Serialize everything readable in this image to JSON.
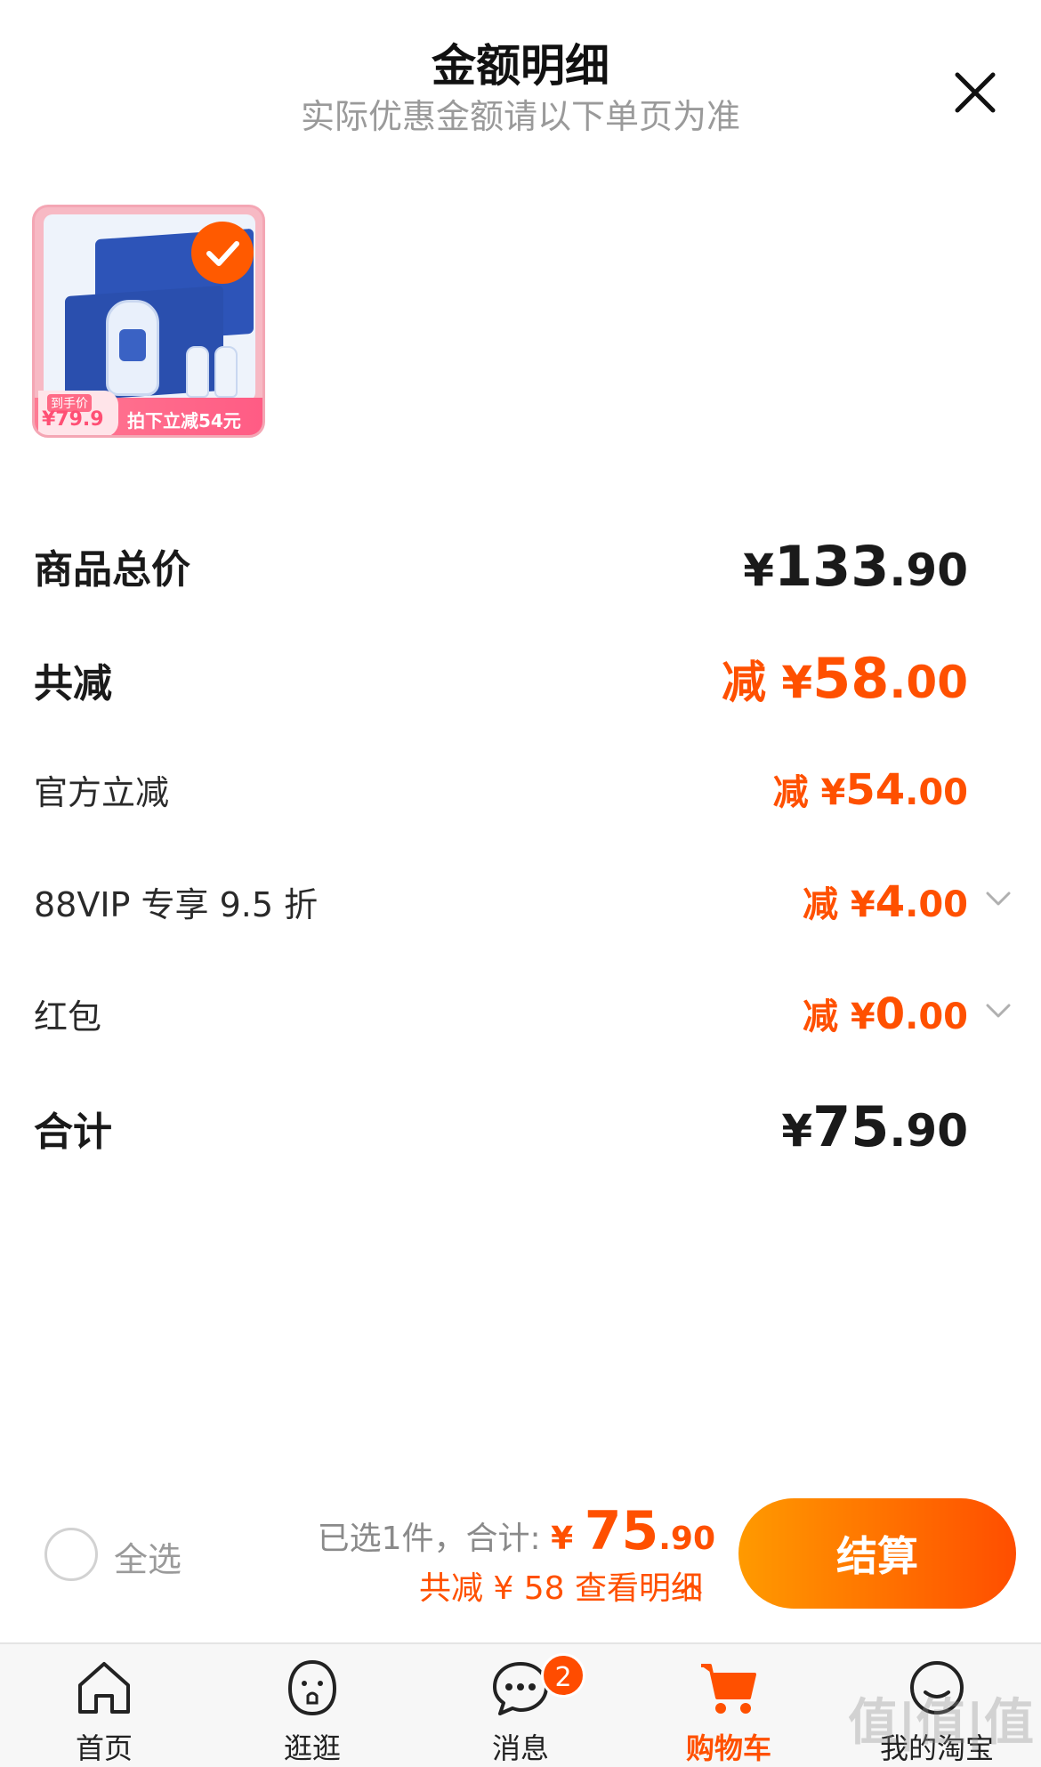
{
  "header": {
    "title": "金额明细",
    "subtitle": "实际优惠金额请以下单页为准"
  },
  "product": {
    "tag": "到手价",
    "price": "¥79.9",
    "promo": "拍下立减54元"
  },
  "rows": {
    "total_label": "商品总价",
    "total_yen": "¥",
    "total_int": "133",
    "total_dec": ".90",
    "discount_label": "共减",
    "discount_prefix": "减 ¥",
    "discount_int": "58",
    "discount_dec": ".00",
    "official_label": "官方立减",
    "official_prefix": "减 ¥",
    "official_int": "54",
    "official_dec": ".00",
    "vip_label": "88VIP 专享 9.5 折",
    "vip_prefix": "减 ¥",
    "vip_int": "4",
    "vip_dec": ".00",
    "redpacket_label": "红包",
    "redpacket_prefix": "减 ¥",
    "redpacket_int": "0",
    "redpacket_dec": ".00",
    "sum_label": "合计",
    "sum_yen": "¥",
    "sum_int": "75",
    "sum_dec": ".90"
  },
  "footer": {
    "select_all": "全选",
    "selected_text": "已选1件，合计: ",
    "yen": "¥ ",
    "total_int": "75",
    "total_dec": ".90",
    "saved_text": "共减 ¥ 58  查看明细",
    "checkout": "结算"
  },
  "tabs": [
    {
      "label": "首页",
      "icon": "home-icon"
    },
    {
      "label": "逛逛",
      "icon": "explore-icon"
    },
    {
      "label": "消息",
      "icon": "message-icon",
      "badge": "2"
    },
    {
      "label": "购物车",
      "icon": "cart-icon"
    },
    {
      "label": "我的淘宝",
      "icon": "profile-icon"
    }
  ],
  "watermark": "值|值|值",
  "colors": {
    "accent": "#ff5000",
    "muted": "#9a9a9a"
  }
}
